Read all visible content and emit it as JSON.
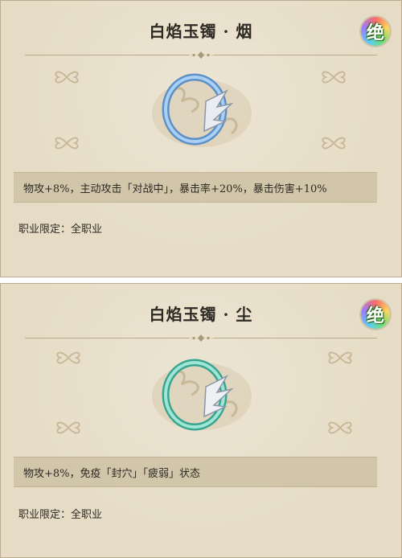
{
  "cards": [
    {
      "title": "白焰玉镯 · 烟",
      "rarity_badge": "绝",
      "ring_color": "#7fb2e6",
      "description": "物攻+8%，主动攻击「对战中」，暴击率+20%，暴击伤害+10%",
      "job_limit": "职业限定：全职业"
    },
    {
      "title": "白焰玉镯 · 尘",
      "rarity_badge": "绝",
      "ring_color": "#5fc9b4",
      "description": "物攻+8%，免疫「封穴」「疲弱」状态",
      "job_limit": "职业限定：全职业"
    }
  ],
  "icons": {
    "badge": "rarity-badge-icon",
    "ring": "jade-bracelet-icon",
    "ornament": "cloud-ornament-icon"
  },
  "colors": {
    "panel_bg": "#e6dcc5",
    "desc_bar": "#d2c6aa",
    "text": "#2e2a24"
  }
}
